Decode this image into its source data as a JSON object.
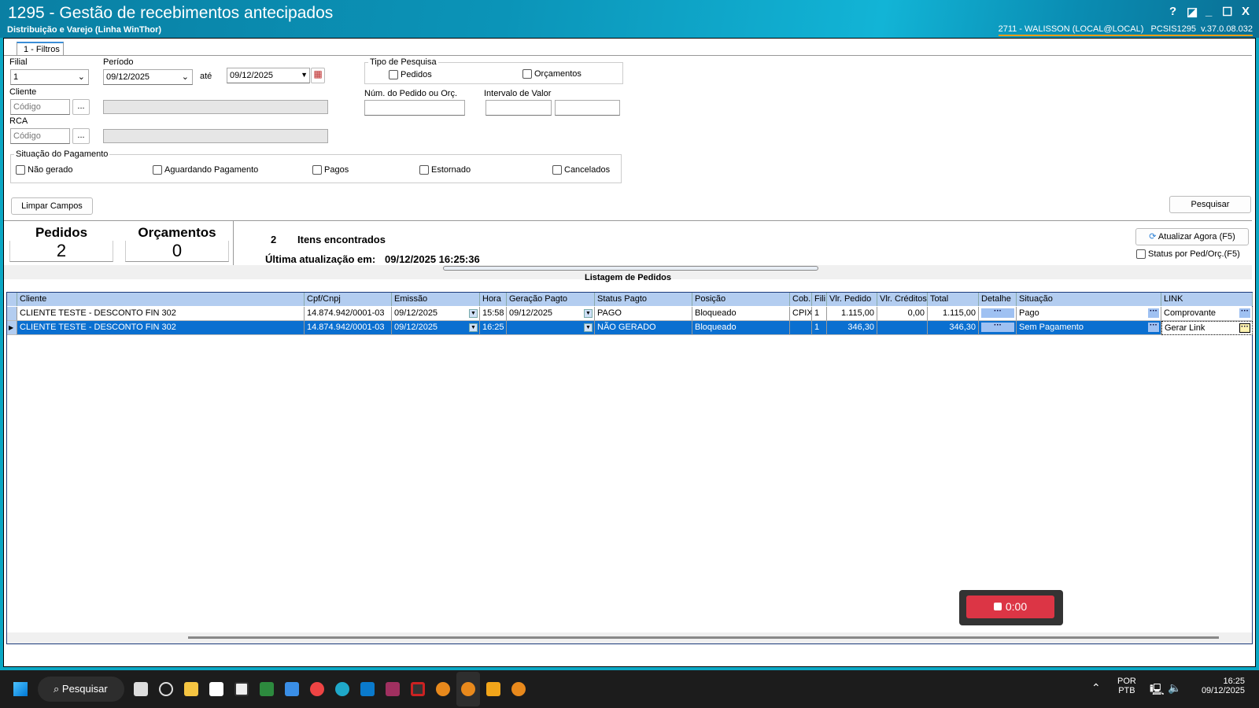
{
  "window": {
    "title": "1295 - Gestão de recebimentos antecipados",
    "subtitle": "Distribuição e Varejo (Linha WinThor)",
    "user_info": "2711 - WALISSON (LOCAL@LOCAL)   PCSIS1295  v.37.0.08.032",
    "controls": [
      "?",
      "◪",
      "_",
      "☐",
      "X"
    ]
  },
  "tab": {
    "label": "1 - Filtros"
  },
  "filters": {
    "filial_label": "Filial",
    "filial_value": "1",
    "periodo_label": "Período",
    "periodo_from": "09/12/2025",
    "ate_label": "até",
    "periodo_to": "09/12/2025",
    "cliente_label": "Cliente",
    "cliente_placeholder": "Código",
    "rca_label": "RCA",
    "rca_placeholder": "Código",
    "ellipsis": "...",
    "tipo_label": "Tipo de Pesquisa",
    "tipo_options": [
      "Pedidos",
      "Orçamentos"
    ],
    "num_label": "Núm. do Pedido ou Orç.",
    "intervalo_label": "Intervalo de Valor",
    "situacao_label": "Situação do Pagamento",
    "situacao_options": [
      "Não gerado",
      "Aguardando Pagamento",
      "Pagos",
      "Estornado",
      "Cancelados"
    ],
    "clear_button": "Limpar Campos",
    "search_button": "Pesquisar"
  },
  "summary": {
    "pedidos_label": "Pedidos",
    "pedidos_count": "2",
    "orcamentos_label": "Orçamentos",
    "orcamentos_count": "0",
    "items_count": "2",
    "items_label": "Itens encontrados",
    "last_update_label": "Última atualização em:",
    "last_update_value": "09/12/2025 16:25:36",
    "refresh_button": "Atualizar Agora (F5)",
    "status_checkbox": "Status por Ped/Orç.(F5)"
  },
  "grid": {
    "title": "Listagem de Pedidos",
    "columns": [
      "Cliente",
      "Cpf/Cnpj",
      "Emissão",
      "Hora",
      "Geração Pagto",
      "Status Pagto",
      "Posição",
      "Cob.",
      "Fili",
      "Vlr. Pedido",
      "Vlr. Créditos",
      "Total",
      "Detalhe",
      "Situação",
      "LINK"
    ],
    "rows": [
      {
        "cliente": "CLIENTE TESTE - DESCONTO FIN 302",
        "cpf": "14.874.942/0001-03",
        "emissao": "09/12/2025",
        "hora": "15:58",
        "geracao": "09/12/2025",
        "status": "PAGO",
        "posicao": "Bloqueado",
        "cob": "CPIX",
        "fili": "1",
        "vlr_pedido": "1.115,00",
        "vlr_creditos": "0,00",
        "total": "1.115,00",
        "detalhe": "···",
        "situacao": "Pago",
        "link": "Comprovante"
      },
      {
        "cliente": "CLIENTE TESTE - DESCONTO FIN 302",
        "cpf": "14.874.942/0001-03",
        "emissao": "09/12/2025",
        "hora": "16:25",
        "geracao": "",
        "status": "NÃO GERADO",
        "posicao": "Bloqueado",
        "cob": "",
        "fili": "1",
        "vlr_pedido": "346,30",
        "vlr_creditos": "",
        "total": "346,30",
        "detalhe": "···",
        "situacao": "Sem Pagamento",
        "link": "Gerar Link"
      }
    ]
  },
  "recorder": {
    "time": "0:00"
  },
  "taskbar": {
    "search": "Pesquisar",
    "lang1": "POR",
    "lang2": "PTB",
    "time": "16:25",
    "date": "09/12/2025"
  }
}
